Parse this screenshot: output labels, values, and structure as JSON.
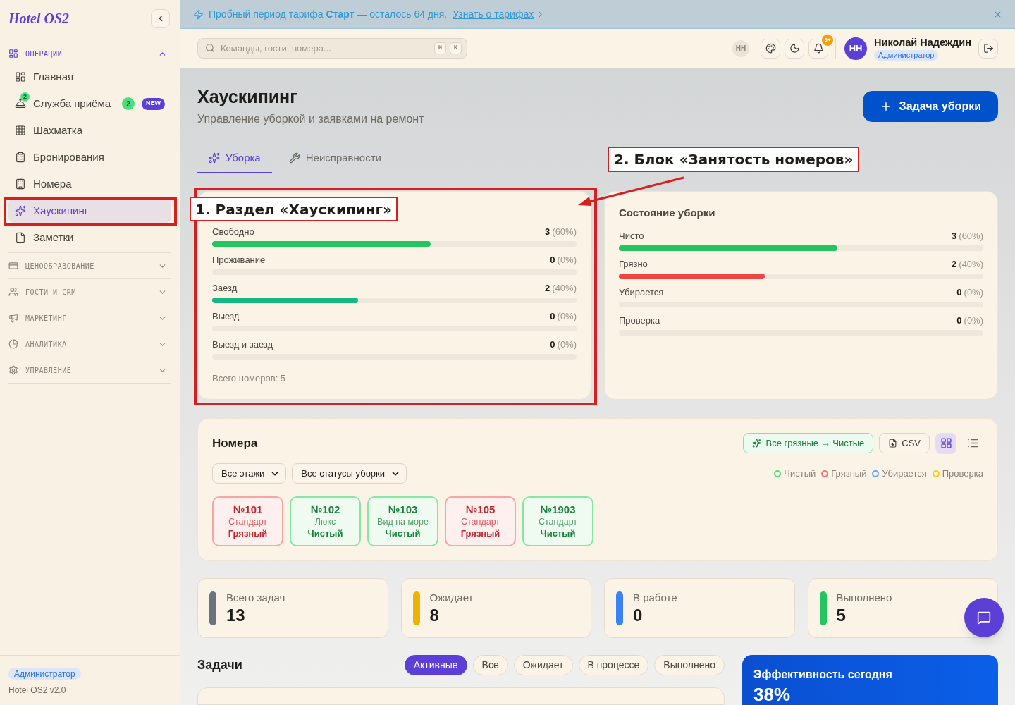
{
  "sidebar": {
    "logo": "Hotel OS2",
    "sections": [
      {
        "title": "ОПЕРАЦИИ",
        "expanded": true,
        "items": [
          {
            "label": "Главная",
            "selected": false
          },
          {
            "label": "Служба приёма",
            "selected": false,
            "icon_badge": "2",
            "count": "2",
            "tag": "NEW"
          },
          {
            "label": "Шахматка",
            "selected": false
          },
          {
            "label": "Бронирования",
            "selected": false
          },
          {
            "label": "Номера",
            "selected": false
          },
          {
            "label": "Хаускипинг",
            "selected": true
          },
          {
            "label": "Заметки",
            "selected": false
          }
        ]
      },
      {
        "title": "ЦЕНООБРАЗОВАНИЕ",
        "expanded": false
      },
      {
        "title": "ГОСТИ И CRM",
        "expanded": false
      },
      {
        "title": "МАРКЕТИНГ",
        "expanded": false
      },
      {
        "title": "АНАЛИТИКА",
        "expanded": false
      },
      {
        "title": "УПРАВЛЕНИЕ",
        "expanded": false
      }
    ],
    "footer": {
      "role": "Администратор",
      "version": "Hotel OS2 v2.0"
    }
  },
  "banner": {
    "text": "Пробный период тарифа **Старт** — осталось 64 дня.",
    "link": "Узнать о тарифах"
  },
  "header": {
    "search": {
      "placeholder": "Команды, гости, номера...",
      "keys": [
        "⌘",
        "K"
      ]
    },
    "presence_chip": "НН",
    "notifications_badge": "9+",
    "user": {
      "initials": "НН",
      "name": "Николай Надеждин",
      "role": "Администратор"
    }
  },
  "page": {
    "title": "Хаускипинг",
    "subtitle": "Управление уборкой и заявками на ремонт",
    "primary_button": "Задача уборки"
  },
  "tabs": [
    {
      "label": "Уборка",
      "selected": true
    },
    {
      "label": "Неисправности",
      "selected": false
    }
  ],
  "occupancy_card": {
    "rows": [
      {
        "label": "Свободно",
        "count": "3",
        "percent": "(60%)",
        "level": 0.6,
        "color": "#22c55e"
      },
      {
        "label": "Проживание",
        "count": "0",
        "percent": "(0%)"
      },
      {
        "label": "Заезд",
        "count": "2",
        "percent": "(40%)",
        "level": 0.4,
        "color": "#10b981"
      },
      {
        "label": "Выезд",
        "count": "0",
        "percent": "(0%)"
      },
      {
        "label": "Выезд и заезд",
        "count": "0",
        "percent": "(0%)"
      }
    ],
    "total": "Всего номеров: 5"
  },
  "cleaning_card": {
    "title": "Состояние уборки",
    "rows": [
      {
        "label": "Чисто",
        "count": "3",
        "percent": "(60%)",
        "level": 0.6,
        "color": "#22c55e"
      },
      {
        "label": "Грязно",
        "count": "2",
        "percent": "(40%)",
        "level": 0.4,
        "color": "#ef4444"
      },
      {
        "label": "Убирается",
        "count": "0",
        "percent": "(0%)"
      },
      {
        "label": "Проверка",
        "count": "0",
        "percent": "(0%)"
      }
    ]
  },
  "rooms": {
    "title": "Номера",
    "bulk_button": "Все грязные → Чистые",
    "export_button": "CSV",
    "views": [
      {
        "kind": "grid",
        "selected": true
      },
      {
        "kind": "list",
        "selected": false
      }
    ],
    "filters": [
      "Все этажи",
      "Все статусы уборки"
    ],
    "legend": [
      {
        "label": "Чистый",
        "color": "#4ade80"
      },
      {
        "label": "Грязный",
        "color": "#f87171"
      },
      {
        "label": "Убирается",
        "color": "#60a5fa"
      },
      {
        "label": "Проверка",
        "color": "#facc15"
      }
    ],
    "tiles": [
      {
        "number": "№101",
        "type": "Стандарт",
        "status": "Грязный",
        "kind": "dirty"
      },
      {
        "number": "№102",
        "type": "Люкс",
        "status": "Чистый",
        "kind": "clean"
      },
      {
        "number": "№103",
        "type": "Вид на море",
        "status": "Чистый",
        "kind": "clean"
      },
      {
        "number": "№105",
        "type": "Стандарт",
        "status": "Грязный",
        "kind": "dirty"
      },
      {
        "number": "№1903",
        "type": "Стандарт",
        "status": "Чистый",
        "kind": "clean"
      }
    ]
  },
  "stats": [
    {
      "label": "Всего задач",
      "value": "13",
      "color": "#6b7280"
    },
    {
      "label": "Ожидает",
      "value": "8",
      "color": "#eab308"
    },
    {
      "label": "В работе",
      "value": "0",
      "color": "#3b82f6"
    },
    {
      "label": "Выполнено",
      "value": "5",
      "color": "#22c55e"
    }
  ],
  "tasks": {
    "title": "Задачи",
    "filters": [
      {
        "label": "Активные",
        "selected": true
      },
      {
        "label": "Все",
        "selected": false
      },
      {
        "label": "Ожидает",
        "selected": false
      },
      {
        "label": "В процессе",
        "selected": false
      },
      {
        "label": "Выполнено",
        "selected": false
      }
    ]
  },
  "efficiency": {
    "title": "Эффективность сегодня",
    "value": "38%"
  },
  "annotations": [
    {
      "label": "1. Раздел «Хаускипинг»"
    },
    {
      "label": "2. Блок «Занятость номеров»"
    }
  ]
}
